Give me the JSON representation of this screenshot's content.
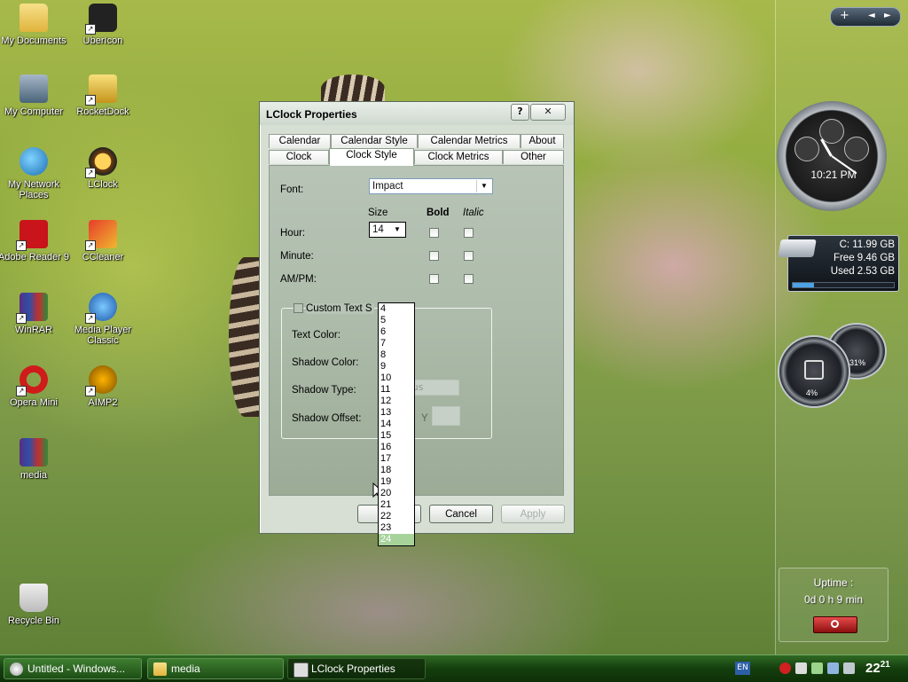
{
  "desktop": {
    "icons": [
      {
        "label": "My Documents"
      },
      {
        "label": "UberIcon"
      },
      {
        "label": "My Computer"
      },
      {
        "label": "RocketDock"
      },
      {
        "label": "My Network Places"
      },
      {
        "label": "LClock"
      },
      {
        "label": "Adobe Reader 9"
      },
      {
        "label": "CCleaner"
      },
      {
        "label": "WinRAR"
      },
      {
        "label": "Media Player Classic"
      },
      {
        "label": "Opera Mini"
      },
      {
        "label": "AIMP2"
      },
      {
        "label": "media"
      },
      {
        "label": "Recycle Bin"
      }
    ]
  },
  "dialog": {
    "title": "LClock Properties",
    "help_glyph": "?",
    "close_glyph": "✕",
    "tabs_row1": [
      "Calendar",
      "Calendar Style",
      "Calendar Metrics",
      "About"
    ],
    "tabs_row2": [
      "Clock",
      "Clock Style",
      "Clock Metrics",
      "Other"
    ],
    "active_tab": "Clock Style",
    "font_label": "Font:",
    "font_value": "Impact",
    "size_header": "Size",
    "bold_header": "Bold",
    "italic_header": "Italic",
    "hour_label": "Hour:",
    "hour_size": "14",
    "minute_label": "Minute:",
    "ampm_label": "AM/PM:",
    "custom_text_label": "Custom Text S",
    "text_color_label": "Text Color:",
    "shadow_color_label": "Shadow Color:",
    "shadow_type_label": "Shadow Type:",
    "shadow_type_value": "ous",
    "shadow_offset_label": "Shadow Offset:",
    "y_label": "Y",
    "size_options": [
      "4",
      "5",
      "6",
      "7",
      "8",
      "9",
      "10",
      "11",
      "12",
      "13",
      "14",
      "15",
      "16",
      "17",
      "18",
      "19",
      "20",
      "21",
      "22",
      "23",
      "24"
    ],
    "highlighted_option": "24",
    "ok_label": "OK",
    "cancel_label": "Cancel",
    "apply_label": "Apply"
  },
  "sidebar": {
    "controls": [
      "+",
      "◄",
      "►"
    ],
    "clock_time": "10:21 PM",
    "drive": {
      "line1": "C:  11.99 GB",
      "line2": "Free 9.46 GB",
      "line3": "Used 2.53 GB",
      "used_fraction": 0.21
    },
    "gauge_cpu": "4%",
    "gauge_mem": "31%",
    "uptime_title": "Uptime :",
    "uptime_value": "0d 0 h 9 min"
  },
  "taskbar": {
    "tasks": [
      {
        "label": "Untitled - Windows..."
      },
      {
        "label": "media"
      },
      {
        "label": "LClock Properties"
      }
    ],
    "lang": "EN",
    "time_hours": "22",
    "time_minutes": "21"
  },
  "colors": {
    "accent_green": "#143e0d",
    "selection": "#a6d39a"
  }
}
